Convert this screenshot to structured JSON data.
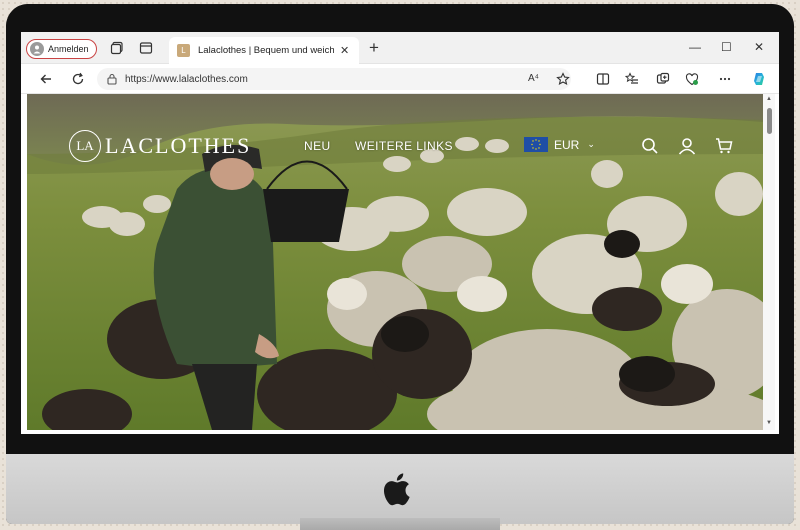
{
  "browser": {
    "profile_label": "Anmelden",
    "tab": {
      "favicon_letter": "L",
      "title": "Lalaclothes | Bequem und weich",
      "close": "✕"
    },
    "new_tab": "+",
    "window_controls": {
      "minimize": "—",
      "maximize": "☐",
      "close": "✕"
    },
    "url": "https://www.lalaclothes.com",
    "read_aloud": "A⁴"
  },
  "site": {
    "logo_mark": "LA",
    "logo_text": "LACLOTHES",
    "nav": [
      {
        "label": "NEU"
      },
      {
        "label": "WEITERE LINKS"
      }
    ],
    "currency": {
      "code": "EUR",
      "chevron": "⌄"
    }
  },
  "colors": {
    "profile_border": "#c94343",
    "flag_blue": "#1f4ea6",
    "copilot_blue": "#2a7be4"
  },
  "icons": {
    "collections": "collections-icon",
    "tab_actions": "tab-actions-icon",
    "back": "back-arrow-icon",
    "refresh": "refresh-icon",
    "lock": "lock-icon",
    "favorite": "star-icon",
    "split": "split-screen-icon",
    "favorites_bar": "favorites-icon",
    "extensions": "extensions-icon",
    "performance": "heart-pulse-icon",
    "more": "more-icon",
    "copilot": "copilot-icon",
    "search": "search-icon",
    "account": "user-icon",
    "cart": "cart-icon",
    "apple": "apple-logo-icon"
  }
}
